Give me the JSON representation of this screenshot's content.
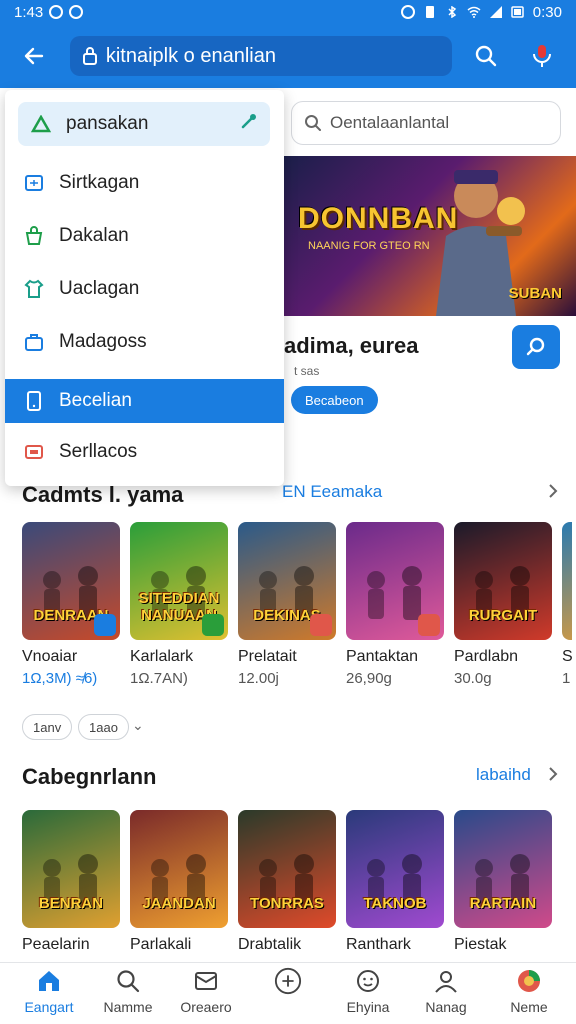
{
  "status": {
    "time": "1:43",
    "battery_time": "0:30"
  },
  "appbar": {
    "search_text": "kitnaiplk o enanlian"
  },
  "menu": {
    "items": [
      {
        "label": "pansakan",
        "icon": "triangle-icon"
      },
      {
        "label": "Sirtkagan",
        "icon": "window-icon"
      },
      {
        "label": "Dakalan",
        "icon": "bag-icon"
      },
      {
        "label": "Uaclagan",
        "icon": "shirt-icon"
      },
      {
        "label": "Madagoss",
        "icon": "briefcase-icon"
      },
      {
        "label": "Becelian",
        "icon": "phone-icon"
      },
      {
        "label": "Serllacos",
        "icon": "tag-icon"
      }
    ],
    "active_index": 5
  },
  "content_search": {
    "placeholder": "Oentalaanlantal"
  },
  "hero": {
    "logo": "DONNBAN",
    "subtitle": "NAANIG FOR GTEO RN",
    "tag": "SUBAN"
  },
  "feature": {
    "title": "adima, eurea",
    "meta": "t sas",
    "pill": "Becabeon"
  },
  "section1": {
    "title": "Cadmts l. yama",
    "link": "EN Eeamaka",
    "cards": [
      {
        "name": "Vnoaiar",
        "meta": "1Ω,3M)  ≉6)",
        "art": "DENRAAN",
        "meta_blue": true
      },
      {
        "name": "Karlalark",
        "meta": "1Ω.7AN)",
        "art": "SITEDDIAN NANUAAN"
      },
      {
        "name": "Prelatait",
        "meta": "12.00j",
        "art": "DEKINAS"
      },
      {
        "name": "Pantaktan",
        "meta": "26,90g",
        "art": ""
      },
      {
        "name": "Pardlabn",
        "meta": "30.0g",
        "art": "RURGAIT"
      },
      {
        "name": "S",
        "meta": "1",
        "art": ""
      }
    ],
    "chips": [
      "1anv",
      "1aao"
    ]
  },
  "section2": {
    "title": "Cabegnrlann",
    "link": "labaihd",
    "cards": [
      {
        "name": "Peaelarin",
        "art": "BENRAN"
      },
      {
        "name": "Parlakali",
        "art": "JAANDAN"
      },
      {
        "name": "Drabtalik",
        "art": "TONRRAS"
      },
      {
        "name": "Ranthark",
        "art": "TAKNOB"
      },
      {
        "name": "Piestak",
        "art": "RARTAIN"
      }
    ]
  },
  "bottomnav": {
    "items": [
      {
        "label": "Eangart",
        "icon": "home-icon"
      },
      {
        "label": "Namme",
        "icon": "search-icon"
      },
      {
        "label": "Oreaero",
        "icon": "inbox-icon"
      },
      {
        "label": "",
        "icon": "plus-circle-icon"
      },
      {
        "label": "Ehyina",
        "icon": "face-icon"
      },
      {
        "label": "Nanag",
        "icon": "person-icon"
      },
      {
        "label": "Neme",
        "icon": "avatar-icon"
      }
    ]
  },
  "colors": {
    "primary": "#1a7de0",
    "menu_top_bg": "#e2f0fb"
  }
}
